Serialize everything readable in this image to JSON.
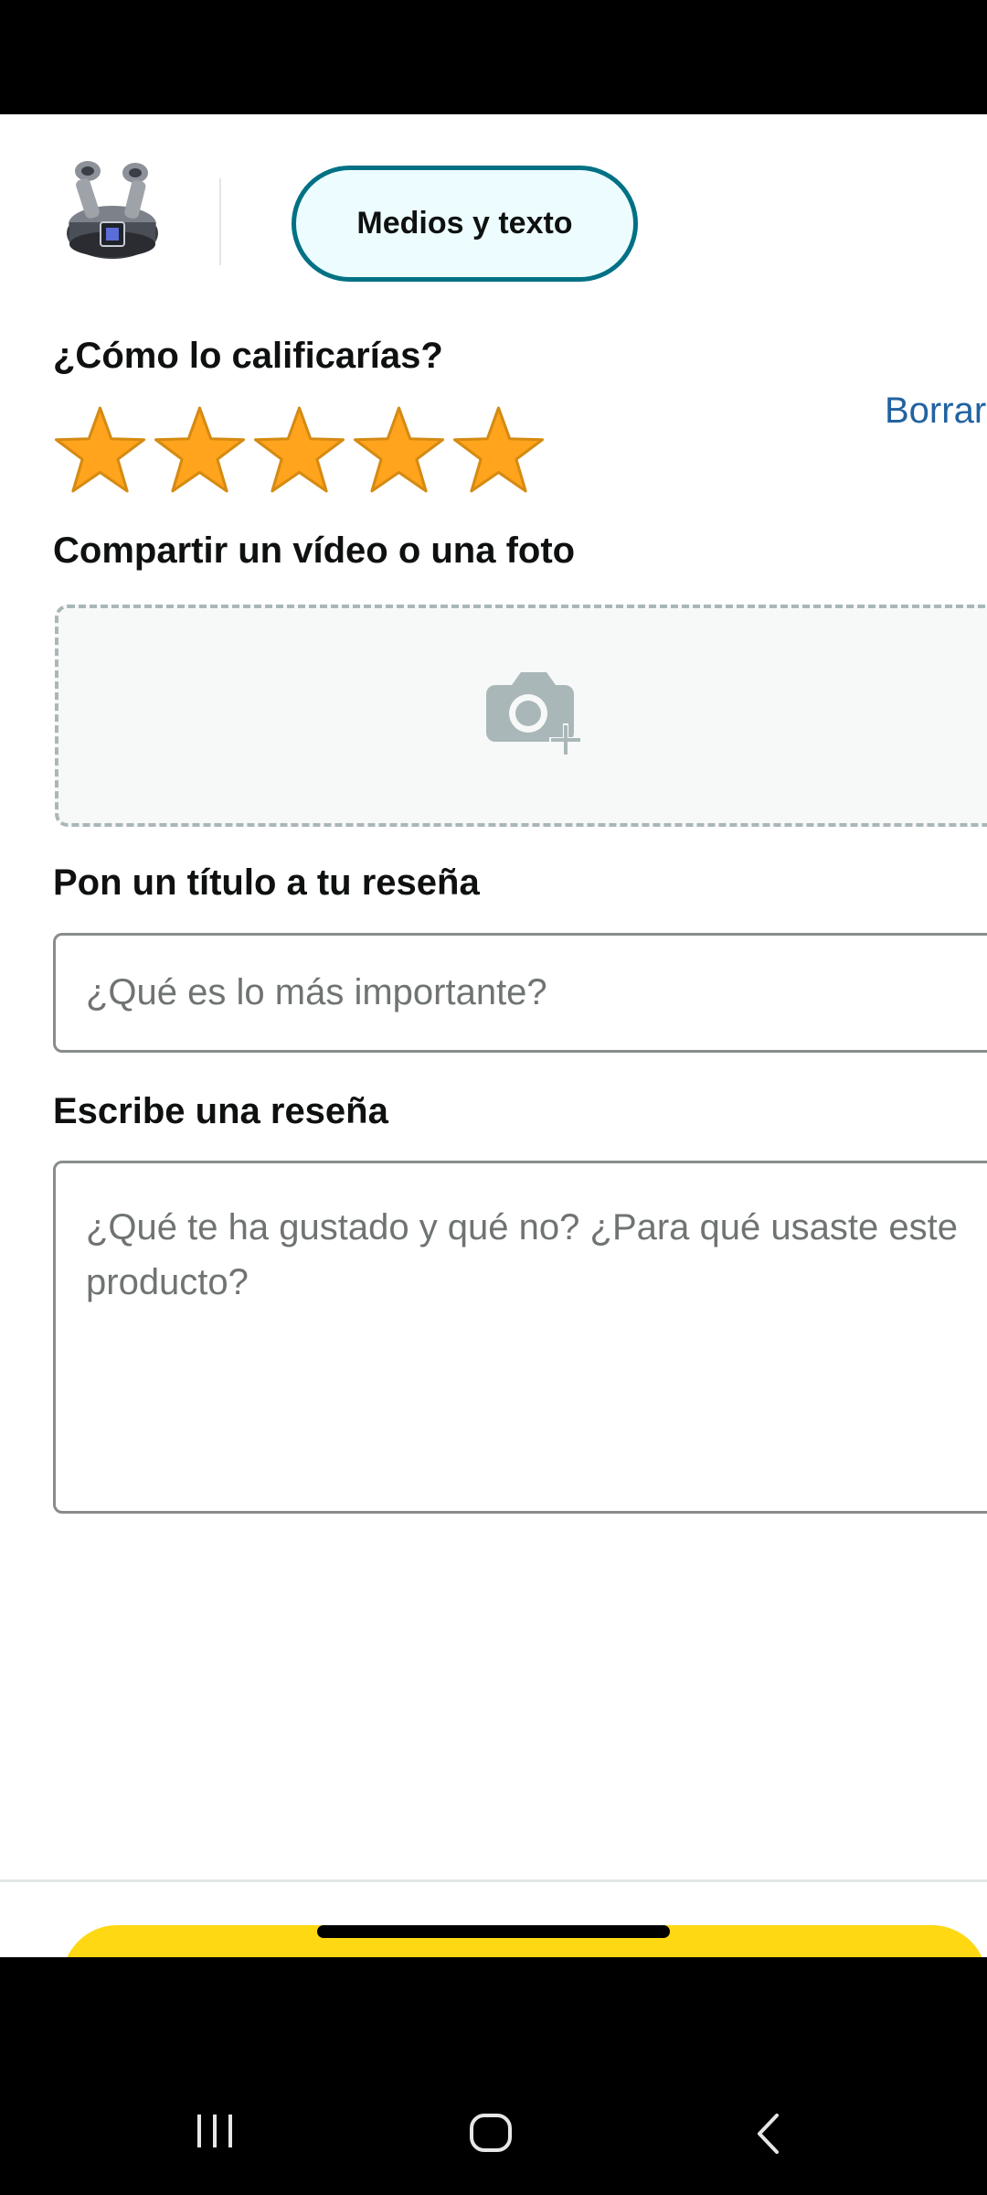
{
  "header": {
    "product_image": "earbuds-product-thumbnail",
    "tab_label": "Medios y texto"
  },
  "rating": {
    "question": "¿Cómo lo calificarías?",
    "selected_stars": 5,
    "max_stars": 5,
    "clear_label": "Borrar"
  },
  "media": {
    "label": "Compartir un vídeo o una foto",
    "icon": "camera-plus-icon"
  },
  "title_field": {
    "label": "Pon un título a tu reseña",
    "placeholder": "¿Qué es lo más importante?"
  },
  "review_field": {
    "label": "Escribe una reseña",
    "placeholder": "¿Qué te ha gustado y qué no? ¿Para qué usaste este producto?"
  },
  "colors": {
    "accent_teal": "#007185",
    "star_gold": "#FFA41C",
    "link_blue": "#2162A1",
    "submit_yellow": "#FFD814"
  },
  "system_nav": {
    "recent_icon": "recent-apps-icon",
    "home_icon": "home-icon",
    "back_icon": "back-icon"
  }
}
